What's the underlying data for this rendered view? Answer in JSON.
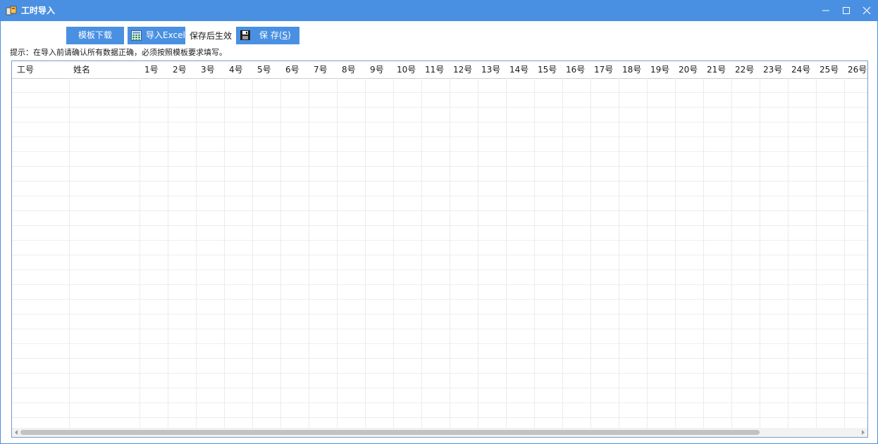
{
  "window": {
    "title": "工时导入",
    "icons": {
      "app": "app-icon",
      "minimize": "minimize-icon",
      "maximize": "maximize-icon",
      "close": "close-icon"
    }
  },
  "toolbar": {
    "template_download_label": "模板下载",
    "import_excel_label": "导入Excel",
    "import_icon": "excel-import-icon",
    "save_note": "保存后生效",
    "save_label_main": "保 存(",
    "save_accel": "S",
    "save_label_end": ")",
    "save_icon": "floppy-disk-icon"
  },
  "hint": "提示：在导入前请确认所有数据正确，必须按照模板要求填写。",
  "table": {
    "columns": [
      "工号",
      "姓名",
      "1号",
      "2号",
      "3号",
      "4号",
      "5号",
      "6号",
      "7号",
      "8号",
      "9号",
      "10号",
      "11号",
      "12号",
      "13号",
      "14号",
      "15号",
      "16号",
      "17号",
      "18号",
      "19号",
      "20号",
      "21号",
      "22号",
      "23号",
      "24号",
      "25号",
      "26号"
    ],
    "rows": []
  },
  "colors": {
    "accent": "#4a90e2",
    "grid_border": "#7a9cc6",
    "grid_line": "#ebebeb",
    "scroll_thumb": "#c2c2c2"
  }
}
